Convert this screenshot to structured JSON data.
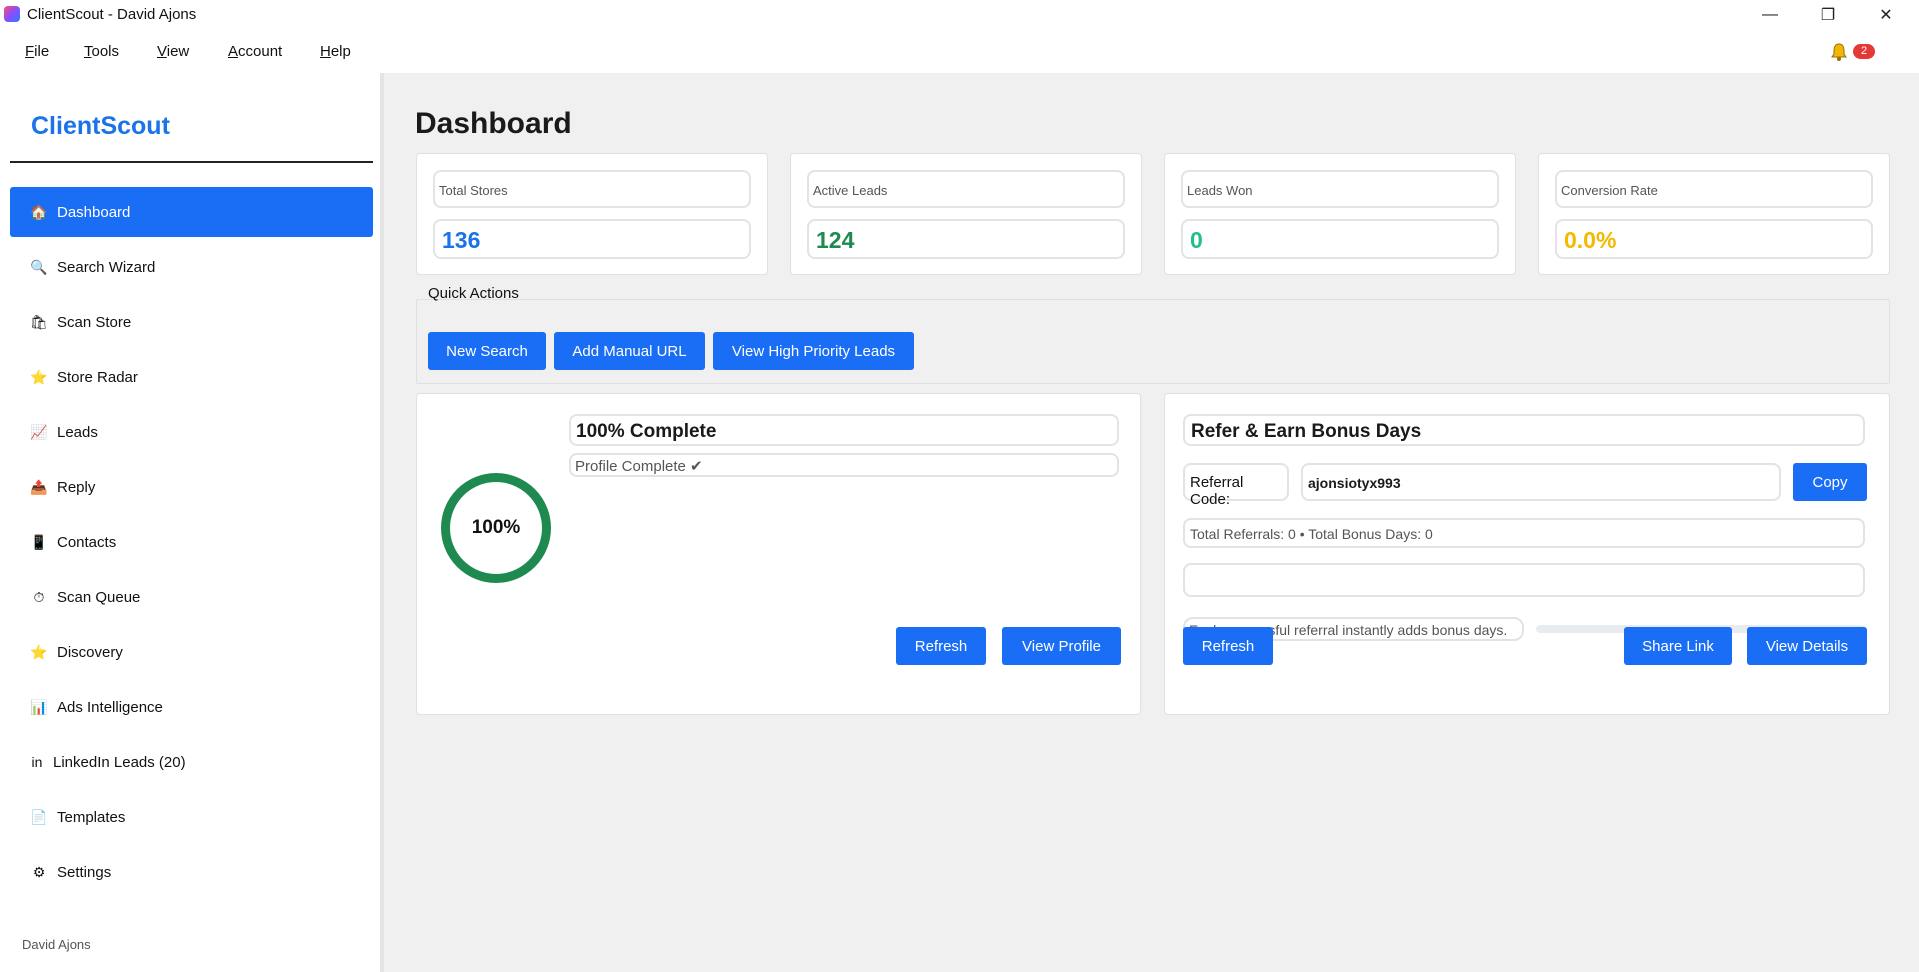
{
  "window": {
    "title": "ClientScout - David Ajons",
    "controls": {
      "minimize": "—",
      "maximize": "❐",
      "close": "✕"
    }
  },
  "menu": {
    "items": [
      "File",
      "Tools",
      "View",
      "Account",
      "Help"
    ],
    "notifications": {
      "icon": "bell-icon",
      "count": "2"
    }
  },
  "sidebar": {
    "brand": "ClientScout",
    "items": [
      {
        "label": "Dashboard",
        "icon": "home-icon",
        "glyph": "🏠",
        "active": true
      },
      {
        "label": "Search Wizard",
        "icon": "magnifier-icon",
        "glyph": "🔍"
      },
      {
        "label": "Scan Store",
        "icon": "store-bag-icon",
        "glyph": "🛍"
      },
      {
        "label": "Store Radar",
        "icon": "star-icon",
        "glyph": "⭐"
      },
      {
        "label": "Leads",
        "icon": "chart-up-icon",
        "glyph": "📈"
      },
      {
        "label": "Reply",
        "icon": "outbox-icon",
        "glyph": "📤"
      },
      {
        "label": "Contacts",
        "icon": "phone-icon",
        "glyph": "📱"
      },
      {
        "label": "Scan Queue",
        "icon": "stopwatch-icon",
        "glyph": "⏱"
      },
      {
        "label": "Discovery",
        "icon": "star-icon",
        "glyph": "⭐"
      },
      {
        "label": "Ads Intelligence",
        "icon": "bar-chart-icon",
        "glyph": "📊"
      },
      {
        "label": "LinkedIn Leads (20)",
        "icon": "linkedin-icon",
        "glyph": "in"
      },
      {
        "label": "Templates",
        "icon": "document-icon",
        "glyph": "📄"
      },
      {
        "label": "Settings",
        "icon": "gear-icon",
        "glyph": "⚙"
      }
    ],
    "footer_user": "David Ajons"
  },
  "main": {
    "title": "Dashboard",
    "stats": [
      {
        "label": "Total Stores",
        "value": "136",
        "color": "#1a73e8"
      },
      {
        "label": "Active Leads",
        "value": "124",
        "color": "#1e8a4f"
      },
      {
        "label": "Leads Won",
        "value": "0",
        "color": "#21c08b"
      },
      {
        "label": "Conversion Rate",
        "value": "0.0%",
        "color": "#f5b800"
      }
    ],
    "quick_actions": {
      "label": "Quick Actions",
      "buttons": [
        "New Search",
        "Add Manual URL",
        "View High Priority Leads"
      ]
    },
    "profile": {
      "percent_label": "100%",
      "percent_value": 100,
      "title": "100% Complete",
      "status": "Profile Complete ✔",
      "refresh": "Refresh",
      "view_profile": "View Profile",
      "ring_color": "#1e8a4f"
    },
    "referral": {
      "title": "Refer & Earn Bonus Days",
      "code_label": "Referral Code:",
      "code": "ajonsiotyx993",
      "copy": "Copy",
      "stats": "Total Referrals: 0  •  Total Bonus Days: 0",
      "note": "Each successful referral instantly adds bonus days.",
      "progress": 0,
      "refresh": "Refresh",
      "share": "Share Link",
      "details": "View Details"
    },
    "accent_color": "#1a6ef5"
  }
}
